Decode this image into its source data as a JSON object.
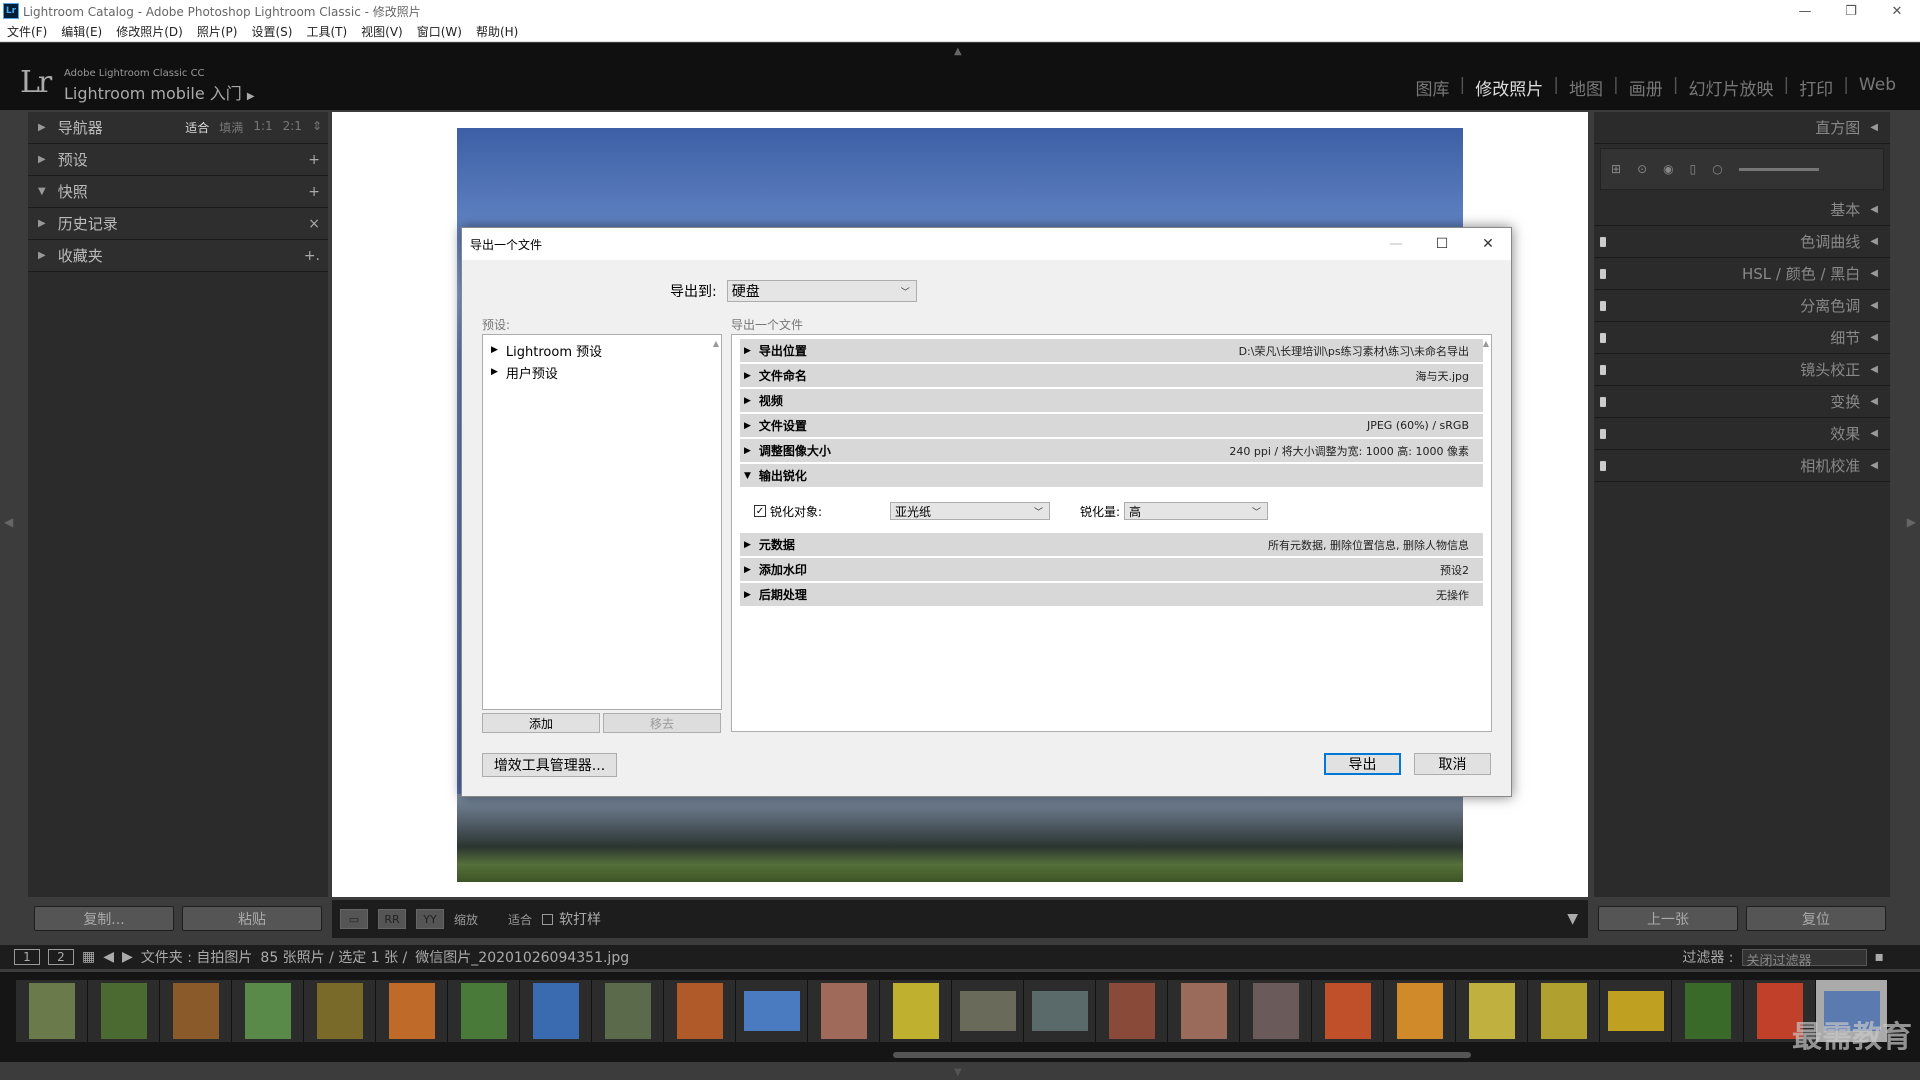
{
  "window": {
    "title": "Lightroom Catalog - Adobe Photoshop Lightroom Classic - 修改照片",
    "app_icon": "Lr"
  },
  "menu": [
    "文件(F)",
    "编辑(E)",
    "修改照片(D)",
    "照片(P)",
    "设置(S)",
    "工具(T)",
    "视图(V)",
    "窗口(W)",
    "帮助(H)"
  ],
  "header": {
    "logo": "Lr",
    "brand_line1": "Adobe Lightroom Classic CC",
    "brand_line2": "Lightroom mobile 入门",
    "modules": [
      "图库",
      "修改照片",
      "地图",
      "画册",
      "幻灯片放映",
      "打印",
      "Web"
    ],
    "active_module": "修改照片"
  },
  "left_panel": {
    "navigator": {
      "label": "导航器",
      "options": [
        "适合",
        "填满",
        "1:1",
        "2:1"
      ],
      "selected": "适合"
    },
    "items": [
      {
        "label": "预设",
        "action": "+"
      },
      {
        "label": "快照",
        "action": "+"
      },
      {
        "label": "历史记录",
        "action": "×"
      },
      {
        "label": "收藏夹",
        "action": "+."
      }
    ],
    "copy_button": "复制...",
    "paste_button": "粘贴"
  },
  "right_panel": {
    "histogram": "直方图",
    "items": [
      "基本",
      "色调曲线",
      "HSL / 颜色 / 黑白",
      "分离色调",
      "细节",
      "镜头校正",
      "变换",
      "效果",
      "相机校准"
    ],
    "prev_button": "上一张",
    "reset_button": "复位"
  },
  "toolbar": {
    "zoom_label": "缩放",
    "zoom_value": "适合",
    "soft_proof": "软打样"
  },
  "filmstrip_header": {
    "page1": "1",
    "page2": "2",
    "folder": "文件夹 : 自拍图片",
    "count": "85 张照片 / 选定 1 张 /",
    "filename": "微信图片_20201026094351.jpg",
    "filter_label": "过滤器 :",
    "filter_value": "关闭过滤器"
  },
  "watermark": "最需教育",
  "dialog": {
    "title": "导出一个文件",
    "export_to_label": "导出到:",
    "export_to_value": "硬盘",
    "presets_label": "预设:",
    "presets": [
      "Lightroom 预设",
      "用户预设"
    ],
    "add_button": "添加",
    "remove_button": "移去",
    "settings_label": "导出一个文件",
    "sections": [
      {
        "label": "导出位置",
        "value": "D:\\荣凡\\长理培训\\ps练习素材\\练习\\未命名导出"
      },
      {
        "label": "文件命名",
        "value": "海与天.jpg"
      },
      {
        "label": "视频",
        "value": ""
      },
      {
        "label": "文件设置",
        "value": "JPEG (60%) / sRGB"
      },
      {
        "label": "调整图像大小",
        "value": "240 ppi / 将大小调整为宽: 1000 高: 1000 像素"
      },
      {
        "label": "输出锐化",
        "value": ""
      }
    ],
    "sharpen": {
      "checkbox_label": "锐化对象:",
      "target": "亚光纸",
      "amount_label": "锐化量:",
      "amount": "高"
    },
    "sections2": [
      {
        "label": "元数据",
        "value": "所有元数据, 删除位置信息, 删除人物信息"
      },
      {
        "label": "添加水印",
        "value": "预设2"
      },
      {
        "label": "后期处理",
        "value": "无操作"
      }
    ],
    "plugin_button": "增效工具管理器...",
    "export_button": "导出",
    "cancel_button": "取消"
  },
  "colors": {
    "accent": "#0078d7",
    "lr_bg": "#2b2b2b"
  }
}
